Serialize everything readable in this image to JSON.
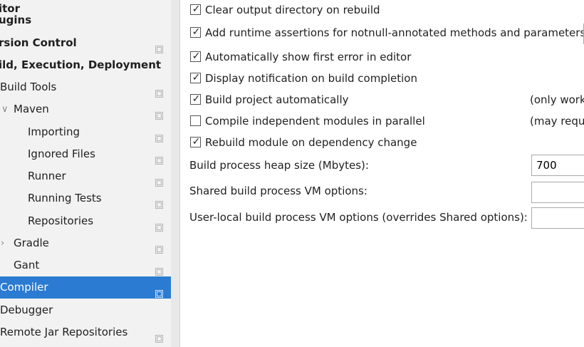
{
  "sidebar": {
    "items": [
      {
        "label": "itor",
        "bold": true
      },
      {
        "label": "ugins",
        "bold": true
      },
      {
        "label": "rsion Control",
        "bold": true
      },
      {
        "label": "ild, Execution, Deployment",
        "bold": true
      },
      {
        "label": "Build Tools"
      },
      {
        "label": "Maven",
        "expanded": true
      },
      {
        "label": "Importing"
      },
      {
        "label": "Ignored Files"
      },
      {
        "label": "Runner"
      },
      {
        "label": "Running Tests"
      },
      {
        "label": "Repositories"
      },
      {
        "label": "Gradle",
        "expanded": false
      },
      {
        "label": "Gant"
      },
      {
        "label": "Compiler",
        "selected": true
      },
      {
        "label": "Debugger"
      },
      {
        "label": "Remote Jar Repositories"
      }
    ]
  },
  "compiler": {
    "options": [
      {
        "label": "Clear output directory on rebuild",
        "checked": true
      },
      {
        "label": "Add runtime assertions for notnull-annotated methods and parameters",
        "checked": true
      },
      {
        "label": "Automatically show first error in editor",
        "checked": true
      },
      {
        "label": "Display notification on build completion",
        "checked": true
      },
      {
        "label": "Build project automatically",
        "checked": true,
        "note": "(only work"
      },
      {
        "label": "Compile independent modules in parallel",
        "checked": false,
        "note": "(may requi"
      },
      {
        "label": "Rebuild module on dependency change",
        "checked": true
      }
    ],
    "heap_size_label": "Build process heap size (Mbytes):",
    "heap_size_value": "700",
    "shared_vm_label": "Shared build process VM options:",
    "shared_vm_value": "",
    "user_vm_label": "User-local build process VM options (overrides Shared options):",
    "user_vm_value": ""
  },
  "colors": {
    "selection": "#2a7bd1",
    "sidebar_bg": "#f2f2f2"
  }
}
